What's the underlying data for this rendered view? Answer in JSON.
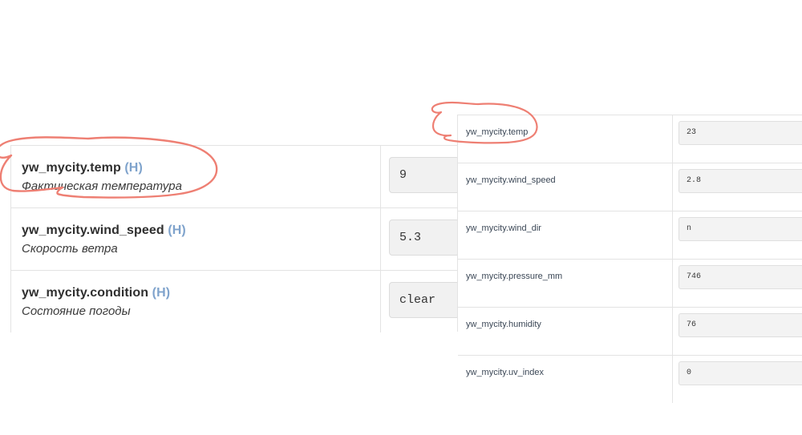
{
  "colors": {
    "annotation_red": "#ee7f73",
    "key_text": "#2f2f2f",
    "h_tag_blue": "#7fa3cc",
    "input_bg": "#f1f1f1",
    "table_border": "#e3e3e3"
  },
  "left_table": {
    "name": "zoomed-entity-attribute-table",
    "h_tag": "(H)",
    "rows": [
      {
        "key": "yw_mycity.temp",
        "tag": "(H)",
        "description": "Фактическая температура",
        "value": "9"
      },
      {
        "key": "yw_mycity.wind_speed",
        "tag": "(H)",
        "description": "Скорость ветра",
        "value": "5.3"
      },
      {
        "key": "yw_mycity.condition",
        "tag": "(H)",
        "description": "Состояние погоды",
        "value": "clear"
      }
    ]
  },
  "right_table": {
    "name": "entity-attribute-table",
    "rows": [
      {
        "key": "yw_mycity.temp",
        "value": "23"
      },
      {
        "key": "yw_mycity.wind_speed",
        "value": "2.8"
      },
      {
        "key": "yw_mycity.wind_dir",
        "value": "n"
      },
      {
        "key": "yw_mycity.pressure_mm",
        "value": "746"
      },
      {
        "key": "yw_mycity.humidity",
        "value": "76"
      },
      {
        "key": "yw_mycity.uv_index",
        "value": "0"
      }
    ]
  },
  "annotations": [
    {
      "name": "red-circle-left",
      "target": "yw_mycity.temp",
      "shape": "hand-drawn-ellipse"
    },
    {
      "name": "red-circle-right",
      "target": "yw_mycity.temp",
      "shape": "hand-drawn-ellipse"
    }
  ]
}
